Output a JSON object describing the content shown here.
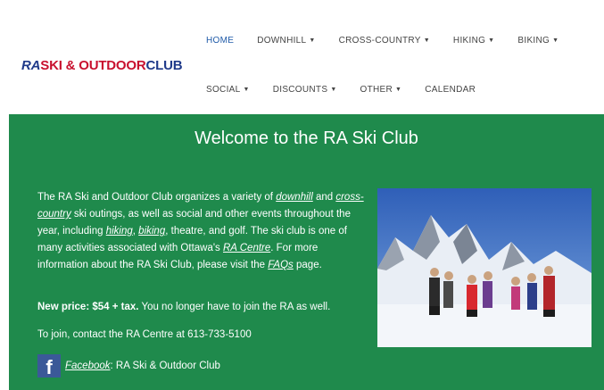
{
  "header": {
    "logo": {
      "ra": "RA",
      "ski": "SKI & OUTDOOR",
      "club": "CLUB"
    },
    "nav_row1": [
      {
        "label": "HOME",
        "caret": false
      },
      {
        "label": "DOWNHILL",
        "caret": true
      },
      {
        "label": "CROSS-COUNTRY",
        "caret": true
      },
      {
        "label": "HIKING",
        "caret": true
      },
      {
        "label": "BIKING",
        "caret": true
      }
    ],
    "nav_row2": [
      {
        "label": "SOCIAL",
        "caret": true
      },
      {
        "label": "DISCOUNTS",
        "caret": true
      },
      {
        "label": "OTHER",
        "caret": true
      },
      {
        "label": "CALENDAR",
        "caret": false
      }
    ]
  },
  "main": {
    "title": "Welcome to the RA Ski Club",
    "intro": {
      "t1": "The RA Ski and Outdoor Club organizes a variety of ",
      "l_downhill": "downhill",
      "t2": " and ",
      "l_cross": "cross-country",
      "t3": " ski outings, as well as social and other events throughout the year, including ",
      "l_hiking": "hiking",
      "t4": ", ",
      "l_biking": "biking",
      "t5": ", theatre, and golf. The ski club is one of many activities associated with Ottawa's ",
      "l_racentre": "RA Centre",
      "t6": ".  For more information about the RA Ski Club, please visit the ",
      "l_faqs": "FAQs",
      "t7": " page."
    },
    "price": {
      "bold": "New price: $54 + tax.",
      "rest": " You no longer have to join the RA as well."
    },
    "contact": "To join, contact the RA Centre at 613-733-5100",
    "facebook": {
      "icon_glyph": "f",
      "link": "Facebook",
      "rest": ": RA Ski & Outdoor Club"
    }
  },
  "colors": {
    "accent_green": "#1f8a4c",
    "nav_active": "#1f5aa8",
    "logo_red": "#c8102e",
    "logo_blue": "#1f3a8a",
    "facebook_blue": "#3b5998"
  },
  "icons": {
    "dropdown": "chevron-down-icon",
    "social": "facebook-icon"
  }
}
